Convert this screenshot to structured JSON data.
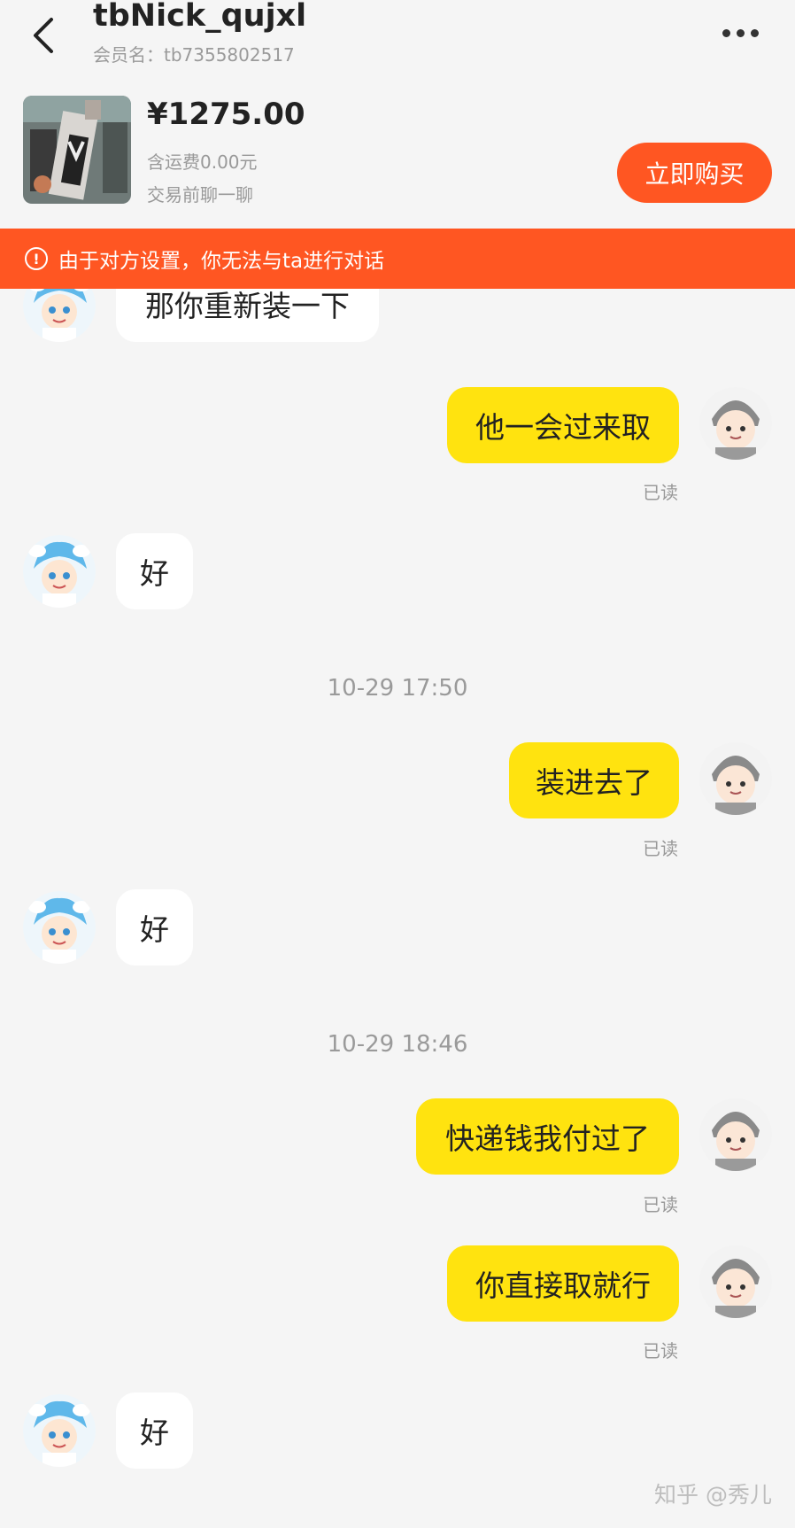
{
  "header": {
    "title": "tbNick_qujxl",
    "member_label": "会员名：tb7355802517"
  },
  "product": {
    "price": "¥1275.00",
    "shipping": "含运费0.00元",
    "chat_hint": "交易前聊一聊",
    "buy_label": "立即购买"
  },
  "banner": {
    "icon": "!",
    "text": "由于对方设置，你无法与ta进行对话"
  },
  "messages": [
    {
      "side": "in",
      "text": "那你重新装一下"
    },
    {
      "side": "out",
      "text": "他一会过来取",
      "status": "已读"
    },
    {
      "side": "in",
      "text": "好"
    },
    {
      "type": "time",
      "text": "10-29 17:50"
    },
    {
      "side": "out",
      "text": "装进去了",
      "status": "已读"
    },
    {
      "side": "in",
      "text": "好"
    },
    {
      "type": "time",
      "text": "10-29 18:46"
    },
    {
      "side": "out",
      "text": "快递钱我付过了",
      "status": "已读"
    },
    {
      "side": "out",
      "text": "你直接取就行",
      "status": "已读"
    },
    {
      "side": "in",
      "text": "好"
    }
  ],
  "watermark": "知乎 @秀儿",
  "colors": {
    "accent": "#ff5622",
    "outgoing_bubble": "#ffe30f",
    "incoming_bubble": "#ffffff",
    "background": "#f5f5f5"
  }
}
